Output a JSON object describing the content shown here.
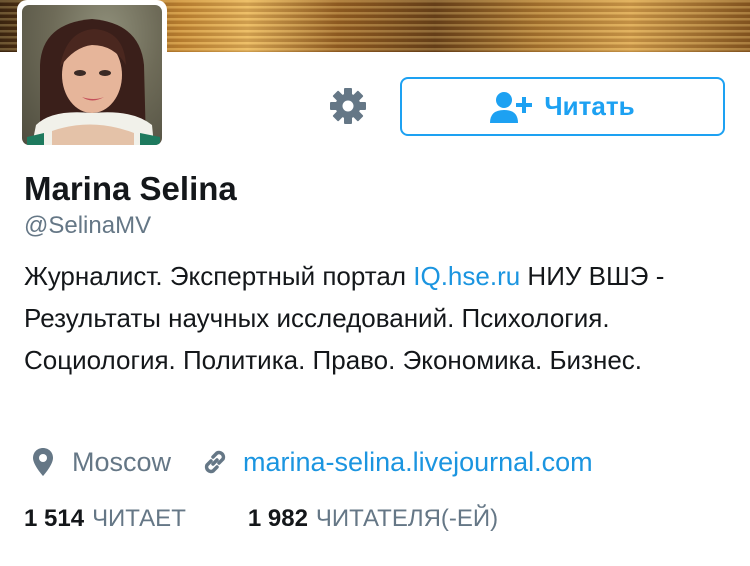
{
  "profile": {
    "name": "Marina Selina",
    "handle": "@SelinaMV",
    "bio": {
      "before_link": "Журналист. Экспертный портал ",
      "link": "IQ.hse.ru",
      "after_link": " НИУ ВШЭ - Результаты научных исследований. Психология. Социология. Политика. Право. Экономика. Бизнес."
    },
    "location": "Moscow",
    "website": "marina-selina.livejournal.com"
  },
  "actions": {
    "follow_label": "Читать",
    "settings_icon": "gear-icon",
    "follow_icon": "add-user-icon"
  },
  "stats": {
    "following_count": "1 514",
    "following_label": "ЧИТАЕТ",
    "followers_count": "1 982",
    "followers_label": "ЧИТАТЕЛЯ(-ЕЙ)"
  },
  "colors": {
    "accent": "#1da1f2",
    "link": "#1b95e0",
    "secondary_text": "#657786",
    "primary_text": "#14171a"
  }
}
